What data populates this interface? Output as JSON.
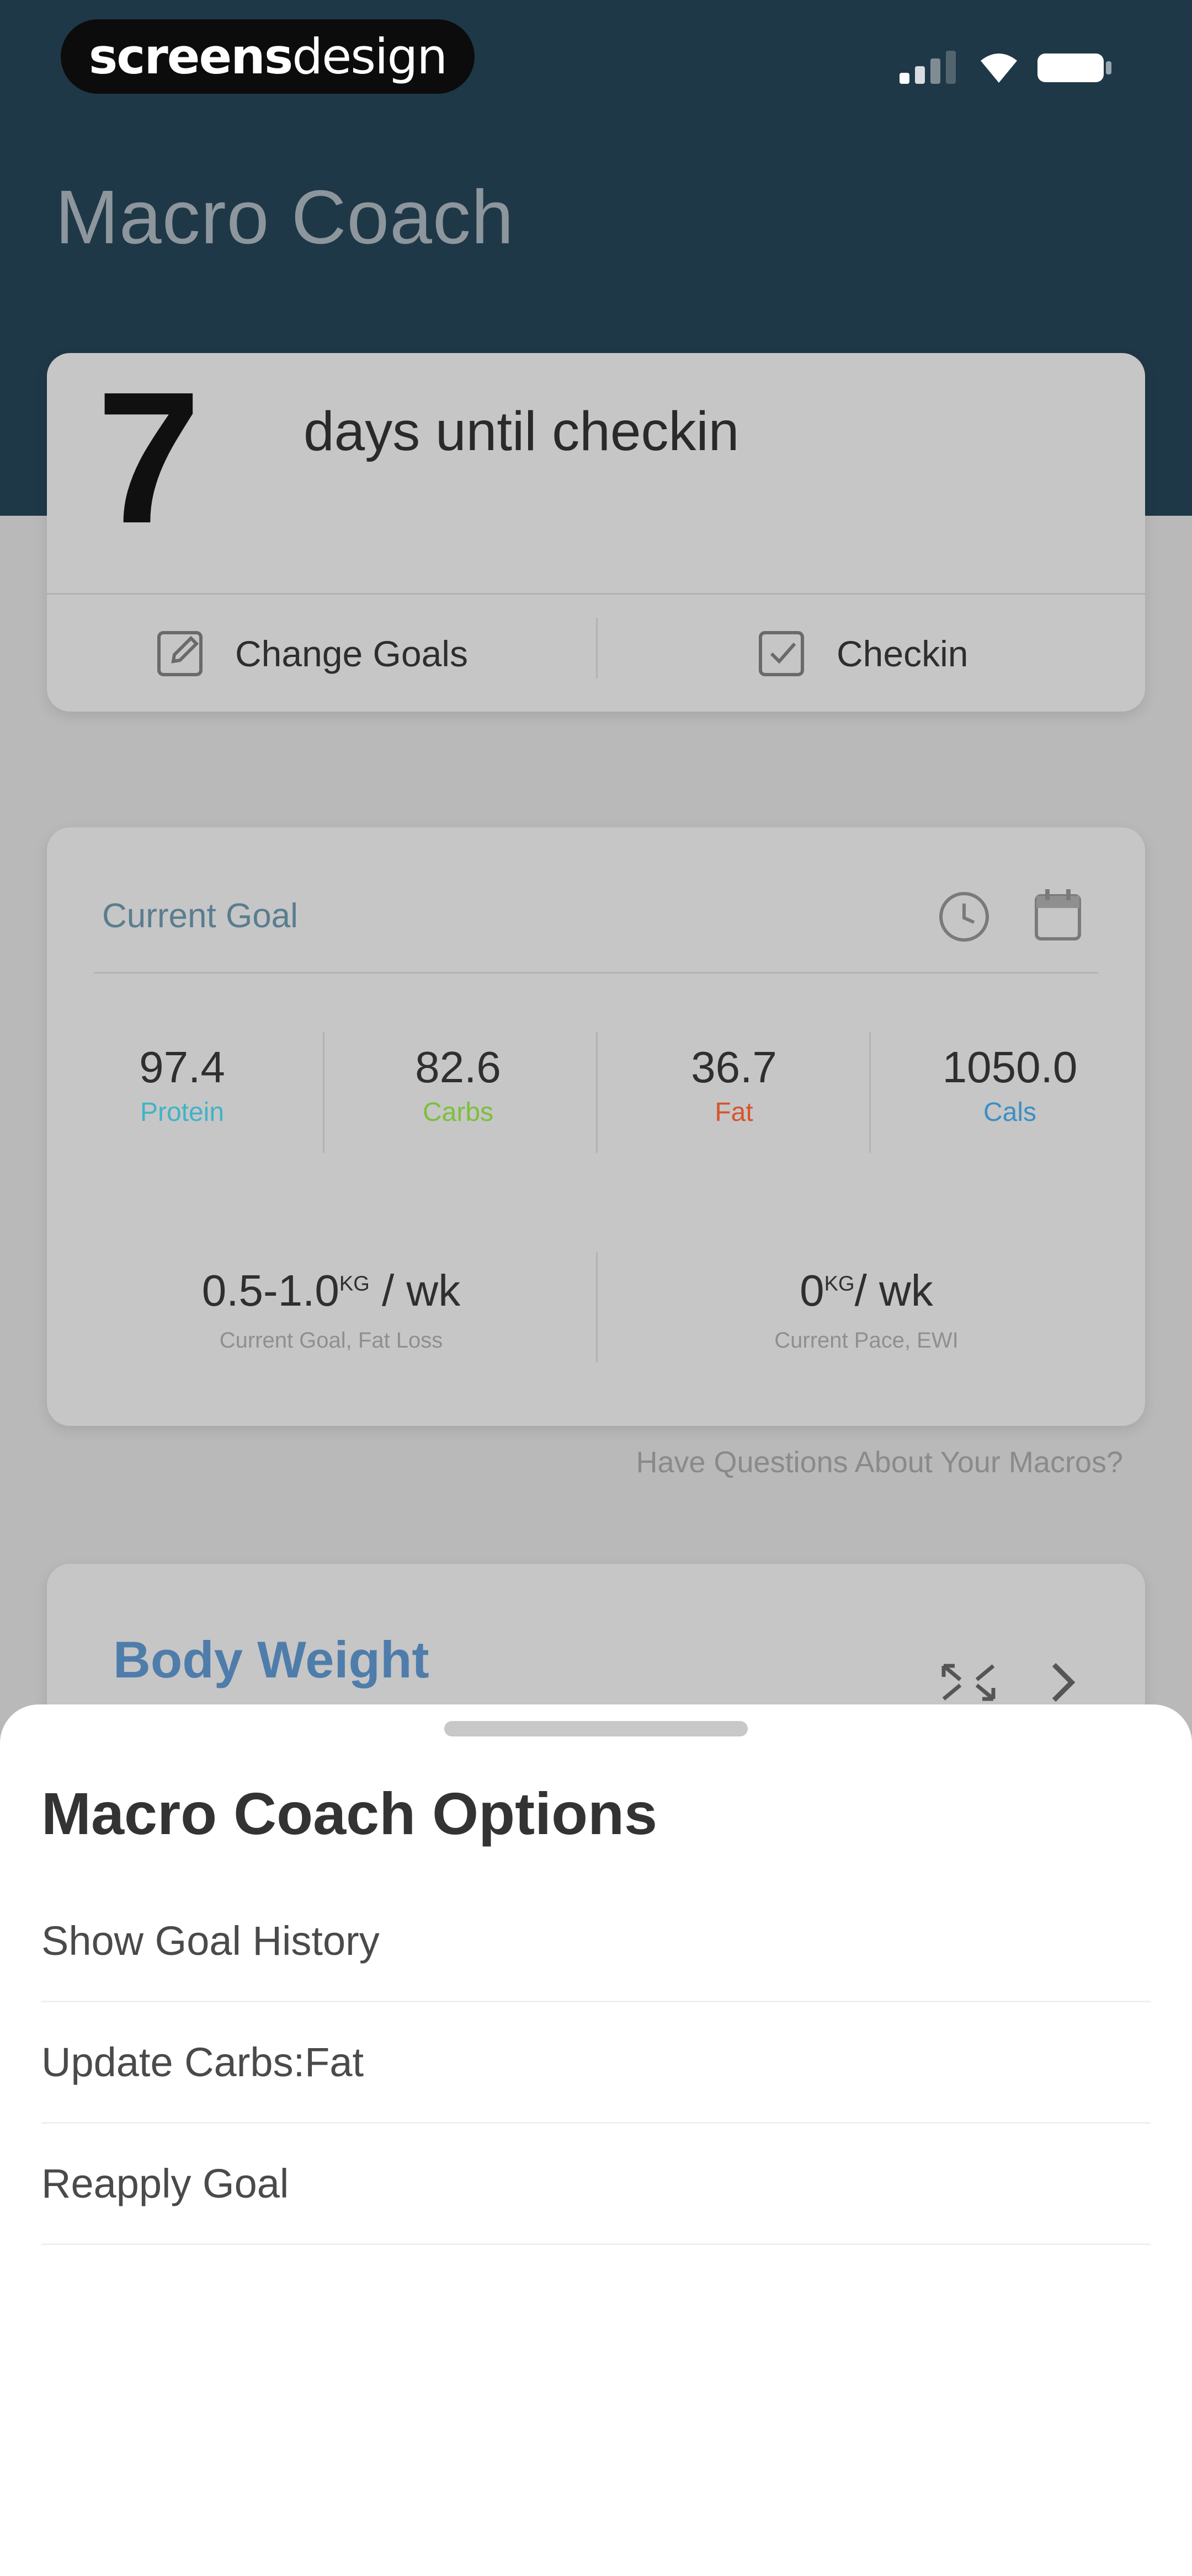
{
  "status_bar": {
    "logo_bold": "screens",
    "logo_light": "design"
  },
  "header": {
    "title": "Macro Coach"
  },
  "checkin_card": {
    "days": "7",
    "days_text": "days until checkin",
    "change_goals_label": "Change Goals",
    "checkin_label": "Checkin"
  },
  "goal_card": {
    "label": "Current Goal",
    "macros": [
      {
        "value": "97.4",
        "label": "Protein",
        "color": "#3fb3c7"
      },
      {
        "value": "82.6",
        "label": "Carbs",
        "color": "#7cbf3c"
      },
      {
        "value": "36.7",
        "label": "Fat",
        "color": "#d9532c"
      },
      {
        "value": "1050.0",
        "label": "Cals",
        "color": "#3b8fc4"
      }
    ],
    "goal_pace": {
      "value": "0.5-1.0",
      "unit_sup": "KG",
      "unit": " / wk",
      "caption": "Current Goal, Fat Loss"
    },
    "current_pace": {
      "value": "0",
      "unit_sup": "KG",
      "unit": "/ wk",
      "caption": "Current Pace, EWI"
    }
  },
  "questions_link": "Have Questions About Your Macros?",
  "weight_card": {
    "title": "Body Weight"
  },
  "sheet": {
    "title": "Macro Coach Options",
    "items": [
      "Show Goal History",
      "Update Carbs:Fat",
      "Reapply Goal"
    ]
  },
  "colors": {
    "header_bg": "#1f3847",
    "accent_blue": "#4f7dab"
  }
}
